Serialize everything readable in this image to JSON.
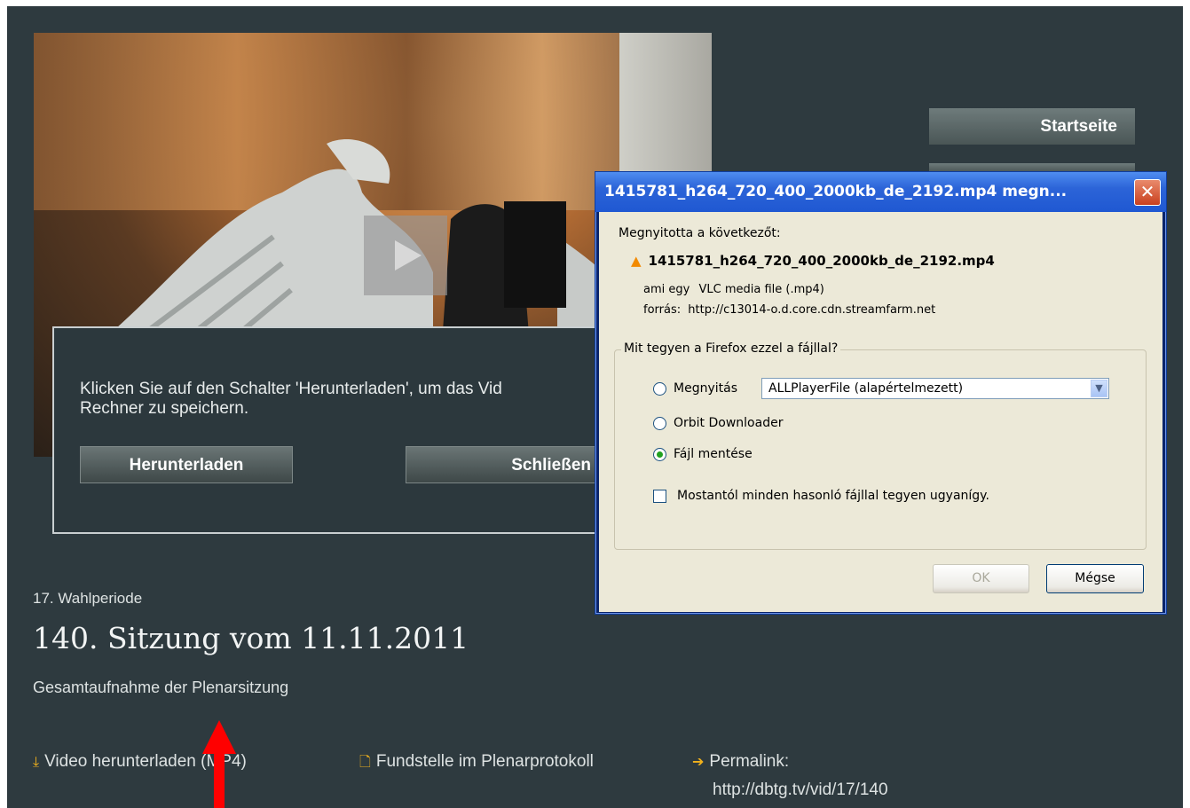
{
  "nav": {
    "home_label": "Startseite"
  },
  "overlay": {
    "message": "Klicken Sie auf den Schalter 'Herunterladen', um das Vid\nRechner zu speichern.",
    "download_label": "Herunterladen",
    "close_label": "Schließen"
  },
  "session": {
    "period": "17. Wahlperiode",
    "title": "140. Sitzung vom 11.11.2011",
    "subtitle": "Gesamtaufnahme der Plenarsitzung"
  },
  "links": {
    "video_download": "Video herunterladen (MP4)",
    "protocol": "Fundstelle im Plenarprotokoll",
    "permalink_label": "Permalink:",
    "permalink_url": "http://dbtg.tv/vid/17/140"
  },
  "dialog": {
    "title": "1415781_h264_720_400_2000kb_de_2192.mp4 megn...",
    "opened_label": "Megnyitotta a következőt:",
    "filename": "1415781_h264_720_400_2000kb_de_2192.mp4",
    "type_prefix": "ami egy",
    "type_value": "VLC media file (.mp4)",
    "source_prefix": "forrás:",
    "source_value": "http://c13014-o.d.core.cdn.streamfarm.net",
    "question": "Mit tegyen a Firefox ezzel a fájllal?",
    "option_open": "Megnyitás",
    "open_app": "ALLPlayerFile (alapértelmezett)",
    "option_orbit": "Orbit Downloader",
    "option_save": "Fájl mentése",
    "remember": "Mostantól minden hasonló fájllal tegyen ugyanígy.",
    "ok": "OK",
    "cancel": "Mégse",
    "selected_option": "save"
  },
  "colors": {
    "page_bg": "#2e3a3f",
    "dialog_bg": "#ece9d8",
    "titlebar": "#2c64d8",
    "arrow": "#ff0000"
  }
}
